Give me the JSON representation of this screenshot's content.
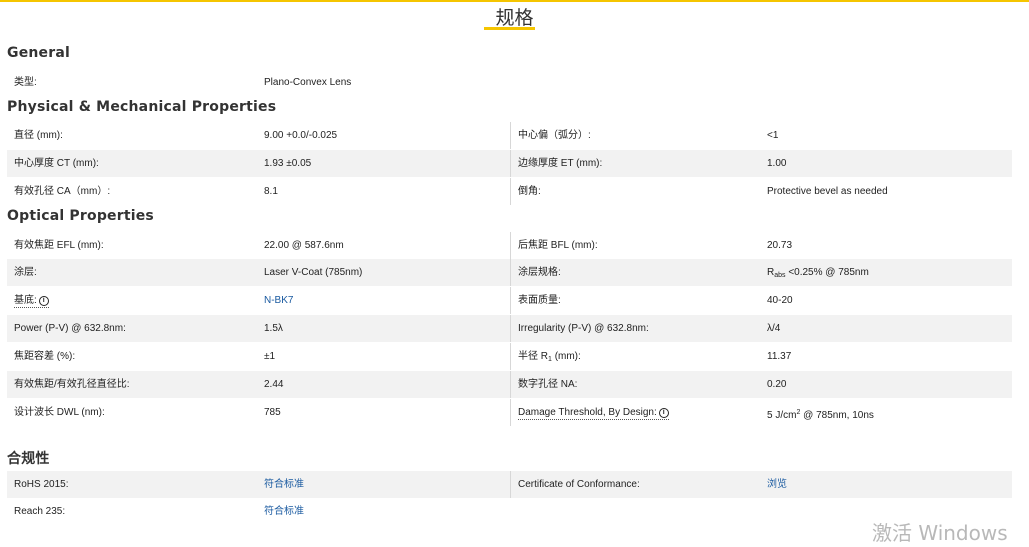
{
  "page": {
    "title": "规格",
    "accent_color": "#f5c500",
    "link_color": "#1a5aa0"
  },
  "sections": {
    "general": {
      "title": "General",
      "rows": [
        {
          "label": "类型:",
          "value": "Plano-Convex Lens"
        }
      ]
    },
    "physical": {
      "title": "Physical & Mechanical Properties",
      "rows": [
        {
          "label": "直径 (mm):",
          "value": "9.00 +0.0/-0.025",
          "label2": "中心偏（弧分）:",
          "value2": "<1"
        },
        {
          "label": "中心厚度 CT (mm):",
          "value": "1.93 ±0.05",
          "label2": "边缘厚度 ET (mm):",
          "value2": "1.00"
        },
        {
          "label": "有效孔径 CA（mm）:",
          "value": "8.1",
          "label2": "倒角:",
          "value2": "Protective bevel as needed"
        }
      ]
    },
    "optical": {
      "title": "Optical Properties",
      "rows": [
        {
          "label": "有效焦距 EFL (mm):",
          "value": "22.00 @ 587.6nm",
          "label2": "后焦距 BFL (mm):",
          "value2": "20.73"
        },
        {
          "label": "涂层:",
          "value": "Laser V-Coat (785nm)",
          "label2": "涂层规格:",
          "value2_prefix": "R",
          "value2_sub": "abs",
          "value2": "<0.25% @ 785nm"
        },
        {
          "label": "基底:",
          "value": "N-BK7",
          "label2": "表面质量:",
          "value2": "40-20"
        },
        {
          "label": "Power (P-V) @ 632.8nm:",
          "value": "1.5λ",
          "label2": "Irregularity (P-V) @ 632.8nm:",
          "value2": "λ/4"
        },
        {
          "label": "焦距容差 (%):",
          "value": "±1",
          "label2_prefix": "半径 R",
          "label2_sub": "1",
          "label2": "(mm):",
          "value2": "11.37"
        },
        {
          "label": "有效焦距/有效孔径直径比:",
          "value": "2.44",
          "label2": "数字孔径 NA:",
          "value2": "0.20"
        },
        {
          "label": "设计波长 DWL (nm):",
          "value": "785",
          "label2": "Damage Threshold, By Design:",
          "value2_prefix": "5 J/cm",
          "value2_sup": "2",
          "value2": "@ 785nm, 10ns"
        }
      ]
    },
    "compliance": {
      "title": "合规性",
      "rows": [
        {
          "label": "RoHS 2015:",
          "value": "符合标准",
          "label2": "Certificate of Conformance:",
          "value2": "浏览"
        },
        {
          "label": "Reach 235:",
          "value": "符合标准"
        }
      ]
    }
  },
  "icons": {
    "info": "info-icon",
    "info_glyph": "i"
  },
  "watermark": "激活 Windows"
}
